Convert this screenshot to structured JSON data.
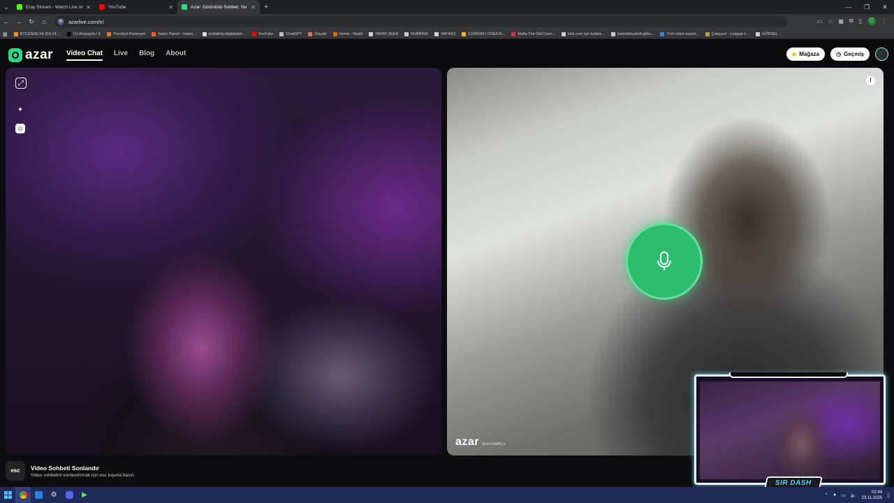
{
  "browser": {
    "tabs": [
      {
        "label": "Eray Stream - Watch Live on Ki",
        "color": "#53fc18",
        "active": false
      },
      {
        "label": "YouTube",
        "color": "#ff0000",
        "active": false
      },
      {
        "label": "Azar: Görüntülü Sohbet, Yer",
        "color": "#2fd686",
        "active": true
      }
    ],
    "url": "azarlive.com/tr/",
    "profile_initial": "C",
    "bookmarks": [
      {
        "label": "BTCUSDE 64.316,01 ...",
        "color": "#f7931a"
      },
      {
        "label": "(1) Anasayfa / X",
        "color": "#000000"
      },
      {
        "label": "Trendyol Pazaryeri",
        "color": "#f27a1a"
      },
      {
        "label": "Satıcı Paneli - Hepsi...",
        "color": "#ff6000"
      },
      {
        "label": "portalbdy.digitalplan...",
        "color": "#dddddd"
      },
      {
        "label": "YouTube",
        "color": "#ff0000"
      },
      {
        "label": "ChatGPT",
        "color": "#bbbbbb"
      },
      {
        "label": "Claude",
        "color": "#d97757"
      },
      {
        "label": "Home - Replit",
        "color": "#f26207"
      },
      {
        "label": "YAPAY ZEKA",
        "color": "#cfcfcf"
      },
      {
        "label": "DUBBING",
        "color": "#cfcfcf"
      },
      {
        "label": "YAYINCI",
        "color": "#cfcfcf"
      },
      {
        "label": "0,005089 | CDE/US...",
        "color": "#f0b90b"
      },
      {
        "label": "Mafia The Old Coun...",
        "color": "#d92b4a"
      },
      {
        "label": "kick.com için kullanı...",
        "color": "#cccccc"
      },
      {
        "label": "beholdmystuff.githu...",
        "color": "#cccccc"
      },
      {
        "label": "Türk video esemi...",
        "color": "#3b82f6"
      },
      {
        "label": "Çalışıyor - League o...",
        "color": "#c89b3c"
      },
      {
        "label": "GÖRSEL",
        "color": "#cfcfcf"
      }
    ]
  },
  "azar": {
    "logo": "azar",
    "nav": [
      {
        "label": "Video Chat",
        "active": true
      },
      {
        "label": "Live",
        "active": false
      },
      {
        "label": "Blog",
        "active": false
      },
      {
        "label": "About",
        "active": false
      }
    ],
    "store_label": "Mağaza",
    "history_label": "Geçmiş",
    "watermark": "azar",
    "watermark_id": "@azr14w8KLX",
    "report_glyph": "!"
  },
  "overlay": {
    "badge": "SIR DASH"
  },
  "hint": {
    "key": "esc",
    "title": "Video Sohbeti Sonlandır",
    "subtitle": "Video sohbetini sonlandırmak için esc tuşuna basın."
  },
  "taskbar": {
    "time": "02:44",
    "date": "23.11.2025"
  }
}
